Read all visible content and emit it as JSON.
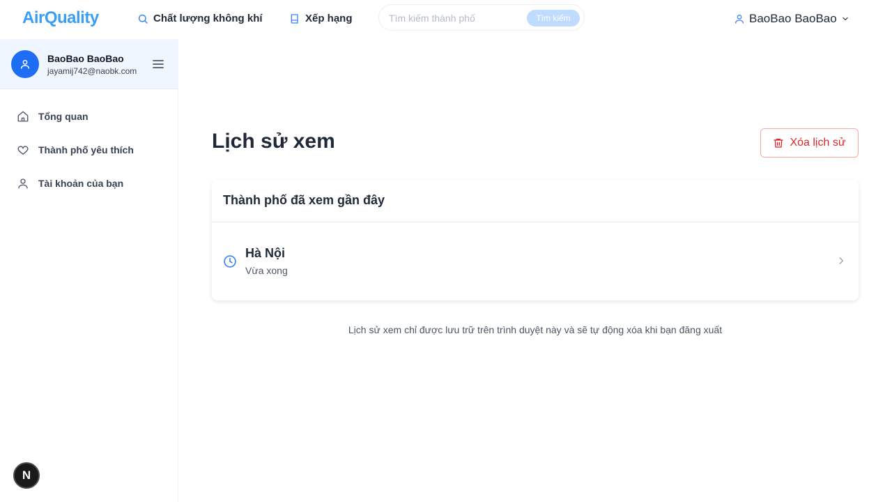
{
  "brand": "AirQuality",
  "nav": {
    "air_quality": "Chất lượng không khí",
    "ranking": "Xếp hạng"
  },
  "search": {
    "placeholder": "Tìm kiếm thành phố",
    "button": "Tìm kiếm"
  },
  "user_menu": {
    "name": "BaoBao BaoBao"
  },
  "sidebar": {
    "profile": {
      "name": "BaoBao BaoBao",
      "email": "jayamij742@naobk.com"
    },
    "items": [
      {
        "label": "Tổng quan",
        "icon": "home-icon"
      },
      {
        "label": "Thành phố yêu thích",
        "icon": "heart-icon"
      },
      {
        "label": "Tài khoản của bạn",
        "icon": "user-icon"
      }
    ],
    "dev_badge": "N"
  },
  "main": {
    "title": "Lịch sử xem",
    "clear_button": "Xóa lịch sử",
    "card_title": "Thành phố đã xem gần đây",
    "history": [
      {
        "city": "Hà Nội",
        "time": "Vừa xong"
      }
    ],
    "footnote": "Lịch sử xem chỉ được lưu trữ trên trình duyệt này và sẽ tự động xóa khi bạn đăng xuất"
  },
  "colors": {
    "brand": "#3b9ef5",
    "primary": "#1d6ef5",
    "danger": "#dc2626",
    "sidebar_profile_bg": "#eff6ff"
  }
}
